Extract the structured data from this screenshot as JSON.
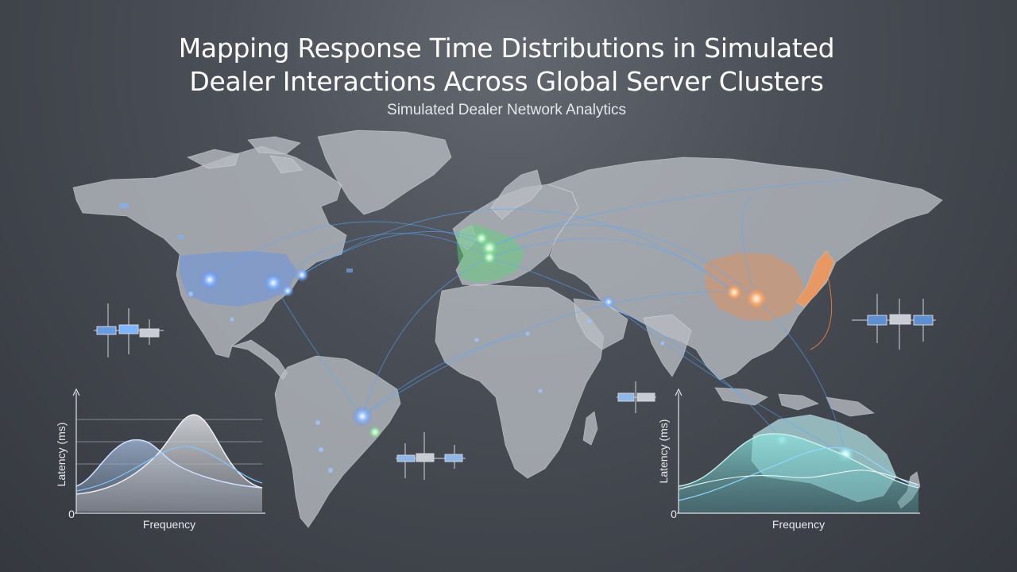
{
  "header": {
    "title_line1": "Mapping Response Time Distributions in Simulated",
    "title_line2": "Dealer Interactions Across Global Server Clusters",
    "subtitle": "Simulated Dealer Network Analytics"
  },
  "colors": {
    "north_america_nodes": "#4f8cff",
    "europe_nodes": "#5ed47a",
    "asia_nodes": "#ff8a3d",
    "oceania_nodes": "#7fe0e0",
    "connection_lines": "#5aa9ff"
  },
  "left_chart": {
    "ylabel": "Latency (ms)",
    "xlabel": "Frequency",
    "origin_label": "0"
  },
  "right_chart": {
    "ylabel": "Latency (ms)",
    "xlabel": "Frequency",
    "origin_label": "0"
  }
}
